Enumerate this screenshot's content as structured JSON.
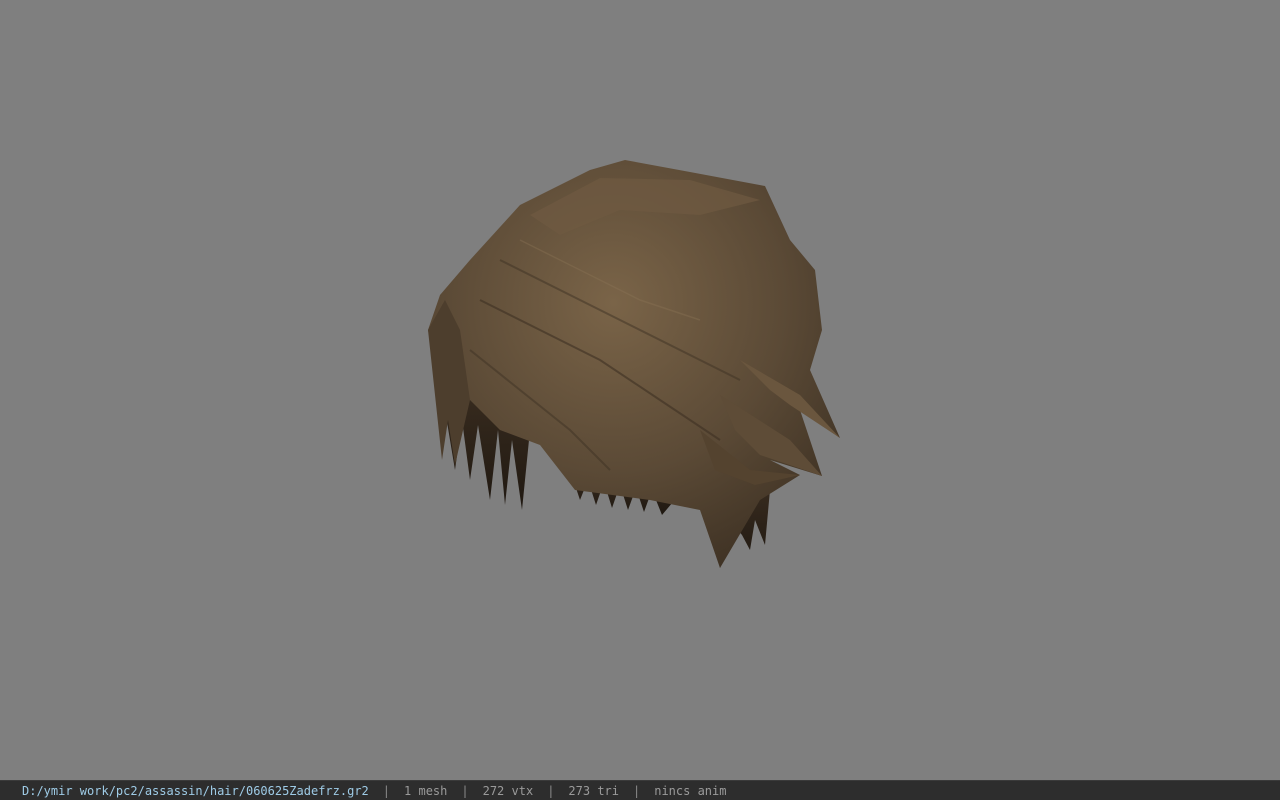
{
  "viewport": {
    "background": "#7f7f7f",
    "model": {
      "icon": "hair-mesh-icon",
      "base_color": "#5b4a36",
      "shadow_color": "#2e241a",
      "highlight_color": "#7a6448"
    }
  },
  "status": {
    "file_path": "D:/ymir work/pc2/assassin/hair/060625Zadefrz.gr2",
    "separator": "|",
    "mesh_count": "1 mesh",
    "vertex_count": "272 vtx",
    "triangle_count": "273 tri",
    "anim_status": "nincs anim",
    "path_color": "#9ecbe6",
    "text_color": "#9a9a9a"
  }
}
